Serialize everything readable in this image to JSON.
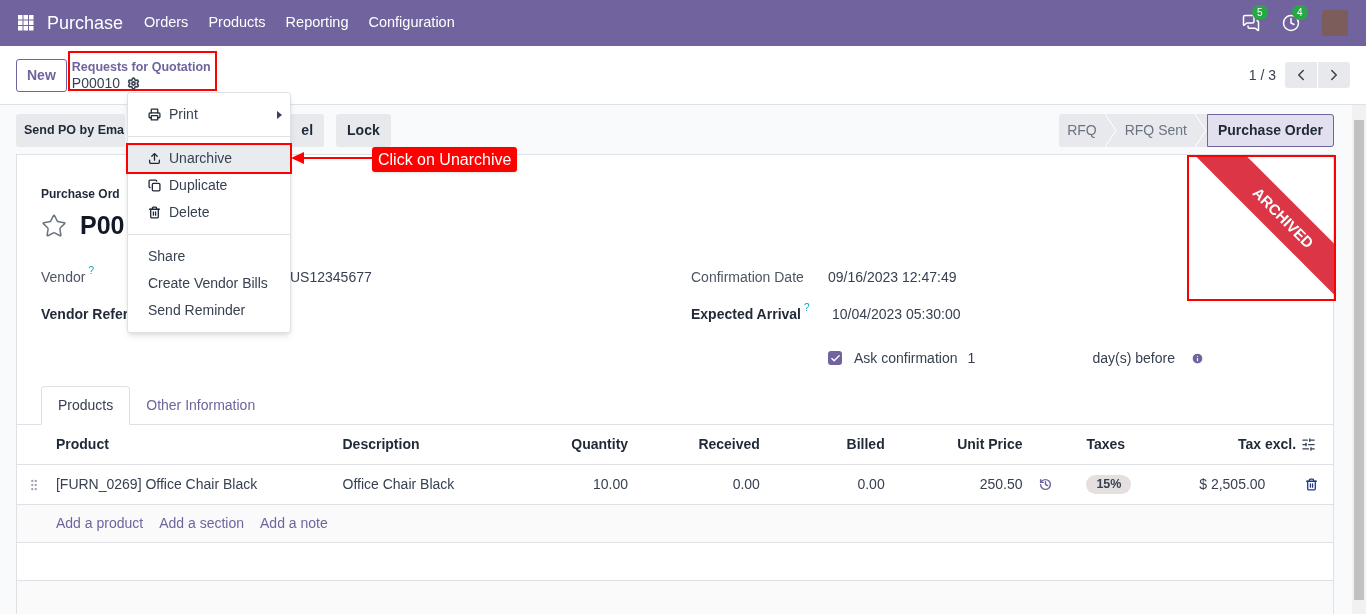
{
  "navbar": {
    "app_name": "Purchase",
    "menu": [
      "Orders",
      "Products",
      "Reporting",
      "Configuration"
    ],
    "systray": [
      {
        "kind": "messages",
        "badge": "5"
      },
      {
        "kind": "activities",
        "badge": "4"
      }
    ]
  },
  "control_panel": {
    "new_button": "New",
    "breadcrumb": {
      "parent": "Requests for Quotation",
      "current": "P00010"
    },
    "pager": "1 / 3"
  },
  "action_buttons": [
    "Send PO by Ema",
    "el",
    "Lock"
  ],
  "status_bar": [
    {
      "label": "RFQ",
      "selected": false
    },
    {
      "label": "RFQ Sent",
      "selected": false
    },
    {
      "label": "Purchase Order",
      "selected": true
    }
  ],
  "action_menu": {
    "groups": [
      [
        {
          "label": "Print",
          "kind": "printer",
          "submenu": true,
          "selected": false
        }
      ],
      [
        {
          "label": "Unarchive",
          "kind": "upload",
          "submenu": false,
          "selected": true
        },
        {
          "label": "Duplicate",
          "kind": "copy",
          "submenu": false,
          "selected": false
        },
        {
          "label": "Delete",
          "kind": "trash",
          "submenu": false,
          "selected": false
        }
      ],
      [
        {
          "label": "Share",
          "kind": "text",
          "submenu": false,
          "selected": false
        },
        {
          "label": "Create Vendor Bills",
          "kind": "text",
          "submenu": false,
          "selected": false
        },
        {
          "label": "Send Reminder",
          "kind": "text",
          "submenu": false,
          "selected": false
        }
      ]
    ]
  },
  "annotation": {
    "label": "Click on Unarchive"
  },
  "ribbon": {
    "label": "ARCHIVED"
  },
  "form": {
    "title_label": "Purchase Ord",
    "title": "P00",
    "starred": false,
    "left_fields": [
      {
        "label": "Vendor",
        "help": "?",
        "bold": false,
        "value": "US12345677"
      },
      {
        "label": "Vendor Refer",
        "bold": true
      }
    ],
    "right_fields": [
      {
        "label": "Confirmation Date",
        "bold": false,
        "value": "09/16/2023 12:47:49"
      },
      {
        "label": "Expected Arrival",
        "help": "?",
        "bold": true,
        "value": "10/04/2023 05:30:00"
      }
    ],
    "confirmation": {
      "checked": true,
      "label": "Ask confirmation",
      "days": "1",
      "suffix": "day(s) before"
    }
  },
  "tabs": [
    {
      "label": "Products",
      "selected": true
    },
    {
      "label": "Other Information",
      "selected": false
    }
  ],
  "table": {
    "columns": [
      "Product",
      "Description",
      "Quantity",
      "Received",
      "Billed",
      "Unit Price",
      "Taxes",
      "Tax excl."
    ],
    "rows": [
      {
        "product": "[FURN_0269] Office Chair Black",
        "description": "Office Chair Black",
        "quantity": "10.00",
        "received": "0.00",
        "billed": "0.00",
        "unit_price": "250.50",
        "taxes": [
          "15%"
        ],
        "subtotal": "$ 2,505.00"
      }
    ],
    "add_links": [
      "Add a product",
      "Add a section",
      "Add a note"
    ]
  }
}
